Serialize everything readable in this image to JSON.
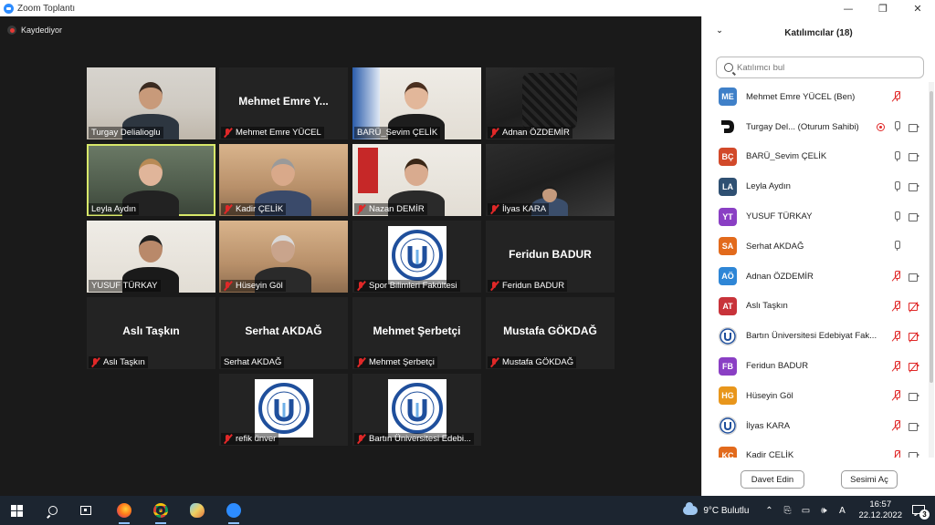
{
  "window": {
    "title": "Zoom Toplantı",
    "minimize_glyph": "—",
    "maximize_glyph": "❐",
    "close_glyph": "✕"
  },
  "recording": {
    "label": "Kaydediyor"
  },
  "tiles": [
    {
      "label": "Turgay Delialioglu",
      "big_name": "",
      "muted": false,
      "speaking": false,
      "kind": "video"
    },
    {
      "label": "Mehmet Emre YÜCEL",
      "big_name": "Mehmet Emre Y...",
      "muted": true,
      "speaking": false,
      "kind": "name"
    },
    {
      "label": "BARÜ_Sevim ÇELİK",
      "big_name": "",
      "muted": false,
      "speaking": false,
      "kind": "video"
    },
    {
      "label": "Adnan ÖZDEMİR",
      "big_name": "",
      "muted": true,
      "speaking": false,
      "kind": "video"
    },
    {
      "label": "Leyla Aydın",
      "big_name": "",
      "muted": false,
      "speaking": true,
      "kind": "video"
    },
    {
      "label": "Kadir ÇELİK",
      "big_name": "",
      "muted": true,
      "speaking": false,
      "kind": "video"
    },
    {
      "label": "Nazan DEMİR",
      "big_name": "",
      "muted": true,
      "speaking": false,
      "kind": "video"
    },
    {
      "label": "İlyas KARA",
      "big_name": "",
      "muted": true,
      "speaking": false,
      "kind": "video"
    },
    {
      "label": "YUSUF TÜRKAY",
      "big_name": "",
      "muted": false,
      "speaking": false,
      "kind": "video"
    },
    {
      "label": "Hüseyin Göl",
      "big_name": "",
      "muted": true,
      "speaking": false,
      "kind": "video"
    },
    {
      "label": "Spor Bilimleri Fakültesi",
      "big_name": "",
      "muted": true,
      "speaking": false,
      "kind": "logo"
    },
    {
      "label": "Feridun BADUR",
      "big_name": "Feridun BADUR",
      "muted": true,
      "speaking": false,
      "kind": "name"
    },
    {
      "label": "Aslı Taşkın",
      "big_name": "Aslı Taşkın",
      "muted": true,
      "speaking": false,
      "kind": "name"
    },
    {
      "label": "Serhat AKDAĞ",
      "big_name": "Serhat AKDAĞ",
      "muted": false,
      "speaking": false,
      "kind": "name"
    },
    {
      "label": "Mehmet Şerbetçi",
      "big_name": "Mehmet Şerbetçi",
      "muted": true,
      "speaking": false,
      "kind": "name"
    },
    {
      "label": "Mustafa GÖKDAĞ",
      "big_name": "Mustafa GÖKDAĞ",
      "muted": true,
      "speaking": false,
      "kind": "name"
    },
    {
      "label": "refik ünver",
      "big_name": "",
      "muted": true,
      "speaking": false,
      "kind": "logo"
    },
    {
      "label": "Bartın Üniversitesi Edebi...",
      "big_name": "",
      "muted": true,
      "speaking": false,
      "kind": "logo"
    }
  ],
  "panel": {
    "title": "Katılımcılar (18)",
    "collapse_glyph": "⌄",
    "search_placeholder": "Katılımcı bul",
    "participants": [
      {
        "initials": "ME",
        "color": "#3f80c8",
        "name": "Mehmet Emre YÜCEL (Ben)",
        "mic": "off",
        "cam": "none",
        "rec": false
      },
      {
        "initials": "",
        "color": "#ffffff",
        "name": "Turgay Del... (Oturum Sahibi)",
        "mic": "on",
        "cam": "on",
        "rec": true,
        "avatar_type": "logo-d"
      },
      {
        "initials": "BÇ",
        "color": "#d2492a",
        "name": "BARÜ_Sevim ÇELİK",
        "mic": "on",
        "cam": "on",
        "rec": false
      },
      {
        "initials": "LA",
        "color": "#2f5072",
        "name": "Leyla Aydın",
        "mic": "on",
        "cam": "on",
        "rec": false
      },
      {
        "initials": "YT",
        "color": "#8a3fc4",
        "name": "YUSUF TÜRKAY",
        "mic": "on",
        "cam": "on",
        "rec": false
      },
      {
        "initials": "SA",
        "color": "#e26a1c",
        "name": "Serhat AKDAĞ",
        "mic": "on",
        "cam": "none",
        "rec": false
      },
      {
        "initials": "AÖ",
        "color": "#2e86d6",
        "name": "Adnan ÖZDEMİR",
        "mic": "off",
        "cam": "on",
        "rec": false
      },
      {
        "initials": "AT",
        "color": "#c8333a",
        "name": "Aslı Taşkın",
        "mic": "off",
        "cam": "off",
        "rec": false
      },
      {
        "initials": "",
        "color": "#ffffff",
        "name": "Bartın Üniversitesi Edebiyat Fak...",
        "mic": "off",
        "cam": "off",
        "rec": false,
        "avatar_type": "logo"
      },
      {
        "initials": "FB",
        "color": "#8a3fc4",
        "name": "Feridun BADUR",
        "mic": "off",
        "cam": "off",
        "rec": false
      },
      {
        "initials": "HG",
        "color": "#e8961c",
        "name": "Hüseyin Göl",
        "mic": "off",
        "cam": "on",
        "rec": false
      },
      {
        "initials": "",
        "color": "#ffffff",
        "name": "İlyas KARA",
        "mic": "off",
        "cam": "on",
        "rec": false,
        "avatar_type": "logo"
      },
      {
        "initials": "KÇ",
        "color": "#e26a1c",
        "name": "Kadir ÇELİK",
        "mic": "off",
        "cam": "on",
        "rec": false
      }
    ],
    "invite_label": "Davet Edin",
    "unmute_label": "Sesimi Aç"
  },
  "taskbar": {
    "weather": "9°C  Bulutlu",
    "time": "16:57",
    "date": "22.12.2022",
    "notifications": "3",
    "tray_glyphs": [
      "⌃",
      "⎘",
      "▭",
      "🕪",
      "A"
    ]
  },
  "colors": {
    "speaking_border": "#d8e86a",
    "muted_red": "#e02828",
    "panel_bg": "#ffffff",
    "meeting_bg": "#1a1a1a"
  }
}
